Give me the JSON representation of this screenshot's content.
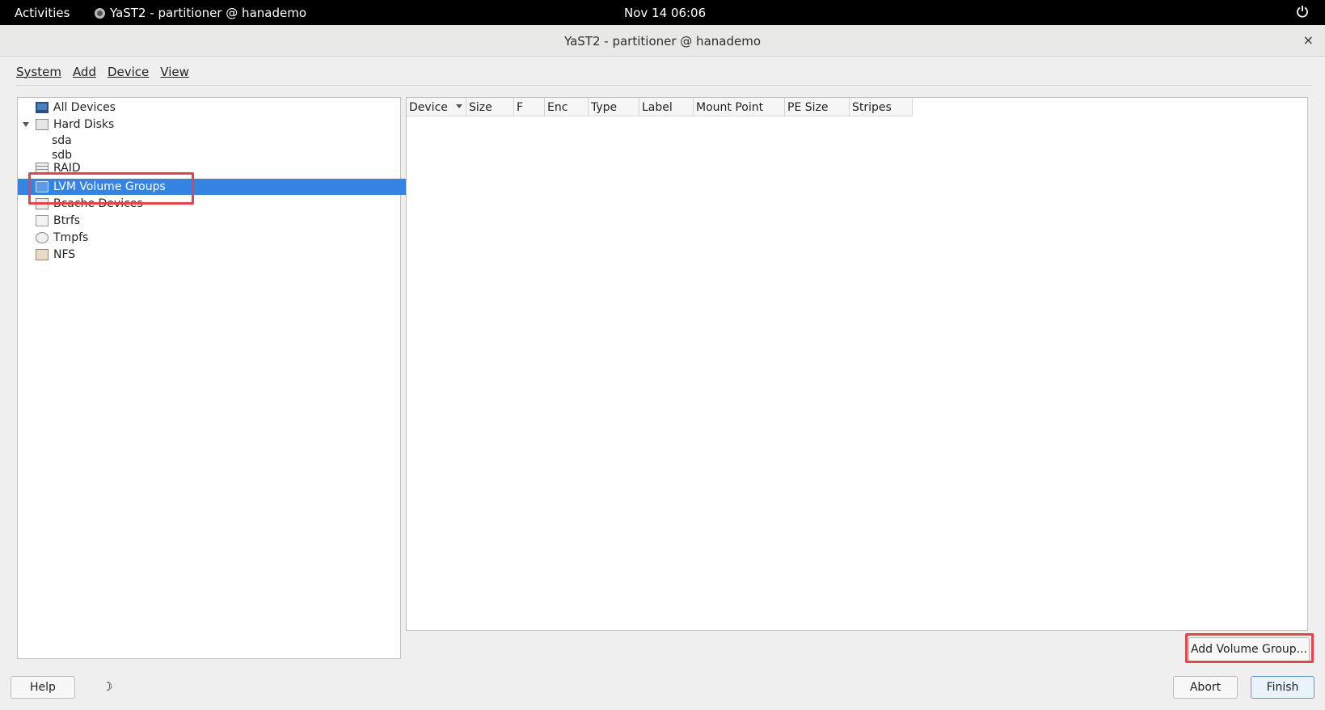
{
  "topbar": {
    "activities": "Activities",
    "app_title": "YaST2 - partitioner @ hanademo",
    "clock": "Nov 14  06:06"
  },
  "window": {
    "title": "YaST2 - partitioner @ hanademo",
    "close": "×"
  },
  "menu": [
    "System",
    "Add",
    "Device",
    "View"
  ],
  "tree": {
    "items": [
      {
        "label": "All Devices",
        "icon": "monitor-icon"
      },
      {
        "label": "Hard Disks",
        "icon": "disk-icon"
      },
      {
        "label": "sda"
      },
      {
        "label": "sdb"
      },
      {
        "label": "RAID",
        "icon": "raid-icon"
      },
      {
        "label": "LVM Volume Groups",
        "icon": "lvm-icon",
        "selected": true
      },
      {
        "label": "Bcache Devices",
        "icon": "bcache-icon"
      },
      {
        "label": "Btrfs",
        "icon": "btrfs-icon"
      },
      {
        "label": "Tmpfs",
        "icon": "tmpfs-icon"
      },
      {
        "label": "NFS",
        "icon": "nfs-icon"
      }
    ]
  },
  "table": {
    "columns": [
      "Device",
      "Size",
      "F",
      "Enc",
      "Type",
      "Label",
      "Mount Point",
      "PE Size",
      "Stripes"
    ],
    "rows": []
  },
  "buttons": {
    "add_volume_group": "Add Volume Group...",
    "help": "Help",
    "abort": "Abort",
    "finish": "Finish"
  },
  "colors": {
    "selection": "#3584e4",
    "highlight": "#e0464f"
  }
}
